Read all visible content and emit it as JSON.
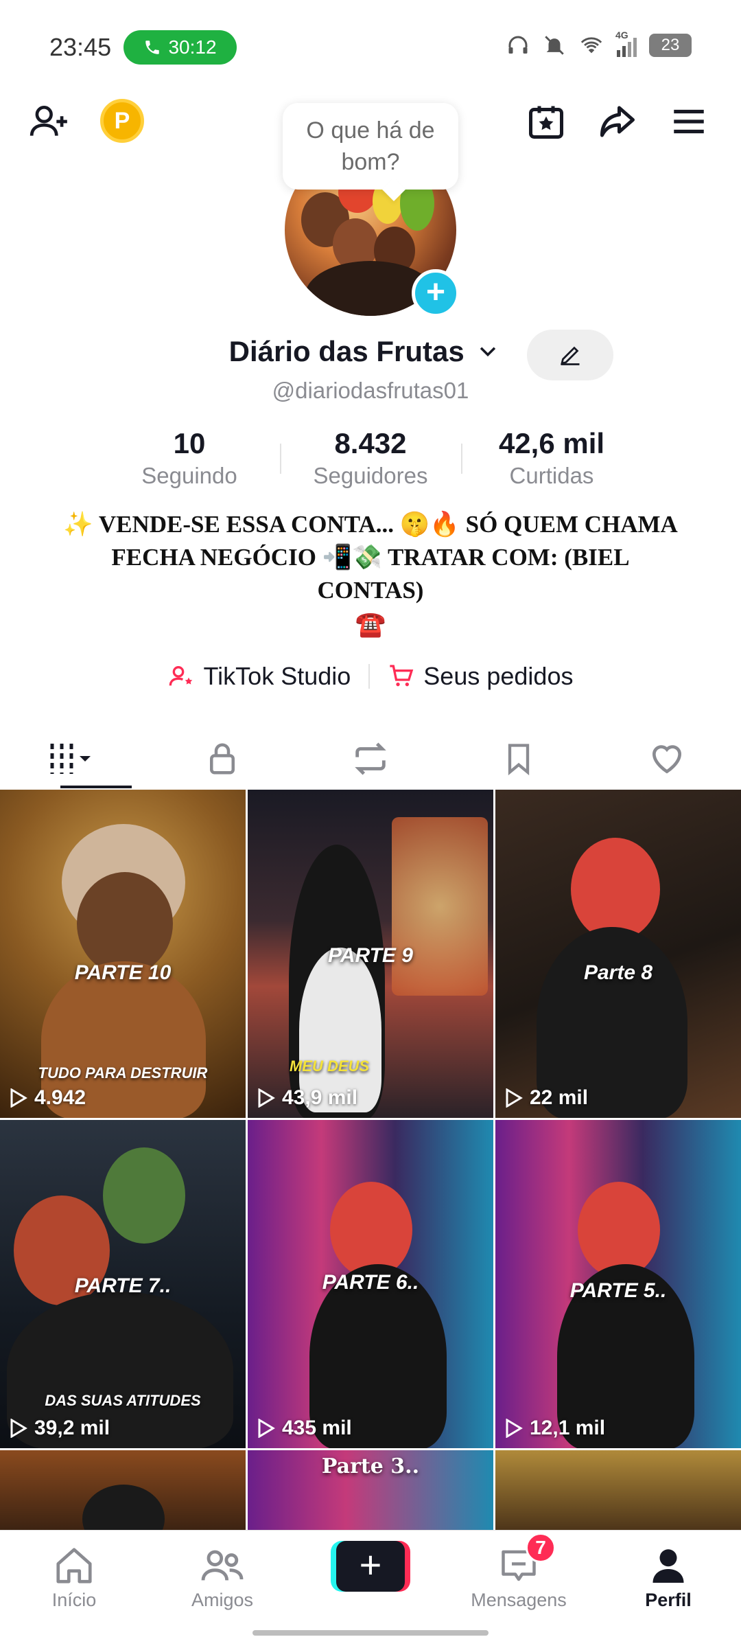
{
  "status_bar": {
    "time": "23:45",
    "call_duration": "30:12",
    "network": "4G",
    "battery": "23"
  },
  "header": {
    "bubble_text": "O que há de bom?",
    "coin_letter": "P"
  },
  "profile": {
    "display_name": "Diário das Frutas",
    "handle": "@diariodasfrutas01",
    "stats": [
      {
        "value": "10",
        "label": "Seguindo"
      },
      {
        "value": "8.432",
        "label": "Seguidores"
      },
      {
        "value": "42,6 mil",
        "label": "Curtidas"
      }
    ],
    "bio": "✨ VENDE-SE ESSA CONTA... 🤫🔥 SÓ QUEM CHAMA FECHA NEGÓCIO 📲💸 TRATAR COM: (BIEL CONTAS)",
    "bio_phone": "☎️"
  },
  "quick_links": {
    "studio": "TikTok Studio",
    "orders": "Seus pedidos"
  },
  "videos": [
    {
      "title": "PARTE 10",
      "caption": "TUDO PARA DESTRUIR",
      "views": "4.942"
    },
    {
      "title": "PARTE 9",
      "caption": "MEU DEUS",
      "views": "43,9 mil"
    },
    {
      "title": "Parte 8",
      "caption": "",
      "views": "22 mil"
    },
    {
      "title": "PARTE 7..",
      "caption": "DAS SUAS ATITUDES",
      "views": "39,2 mil"
    },
    {
      "title": "PARTE 6..",
      "caption": "",
      "views": "435 mil"
    },
    {
      "title": "PARTE 5..",
      "caption": "",
      "views": "12,1 mil"
    },
    {
      "title": "",
      "caption": "",
      "views": ""
    },
    {
      "title": "Parte 3..",
      "caption": "",
      "views": ""
    },
    {
      "title": "",
      "caption": "",
      "views": ""
    }
  ],
  "bottom_nav": {
    "home": "Início",
    "friends": "Amigos",
    "messages": "Mensagens",
    "messages_badge": "7",
    "profile": "Perfil"
  },
  "colors": {
    "accent_pink": "#fe2c55",
    "accent_cyan": "#25f4ee",
    "call_green": "#1fb141"
  }
}
